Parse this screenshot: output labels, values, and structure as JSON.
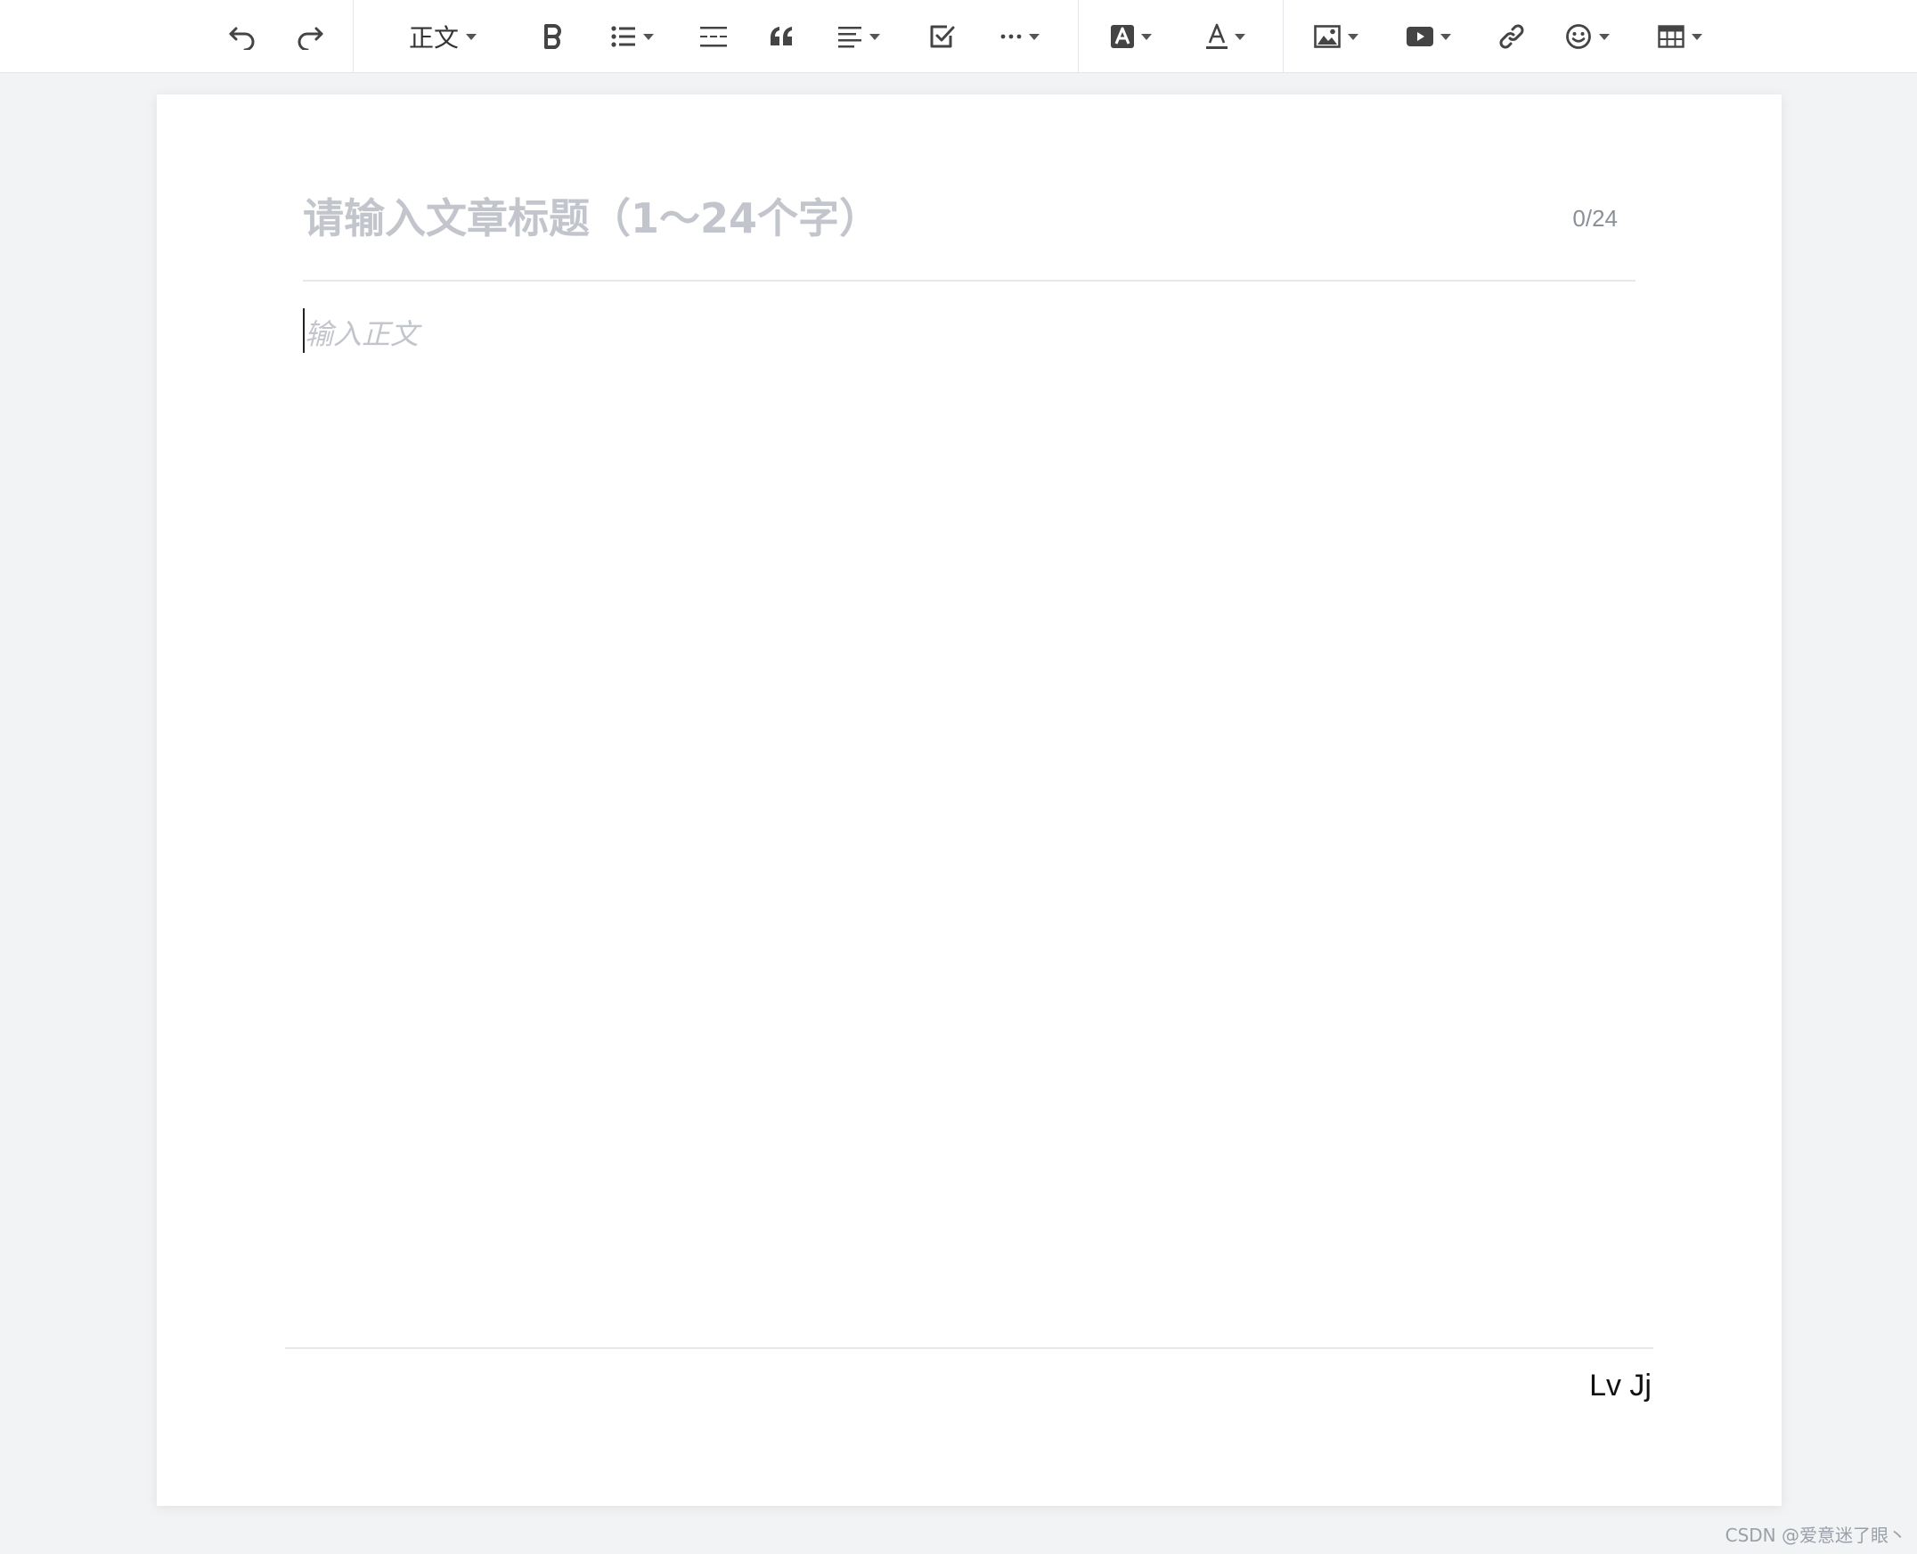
{
  "toolbar": {
    "paragraph_style": "正文",
    "icons": [
      "undo-icon",
      "redo-icon",
      "bold-icon",
      "bullet-list-icon",
      "divider-icon",
      "quote-icon",
      "align-icon",
      "checkbox-icon",
      "more-icon",
      "highlight-icon",
      "font-color-icon",
      "image-icon",
      "video-icon",
      "link-icon",
      "emoji-icon",
      "table-icon"
    ]
  },
  "editor": {
    "title_placeholder": "请输入文章标题（1～24个字）",
    "title_counter": "0/24",
    "body_placeholder": "输入正文"
  },
  "footer": {
    "signature": "Lv Jj"
  },
  "watermark": "CSDN @爱意迷了眼丶"
}
